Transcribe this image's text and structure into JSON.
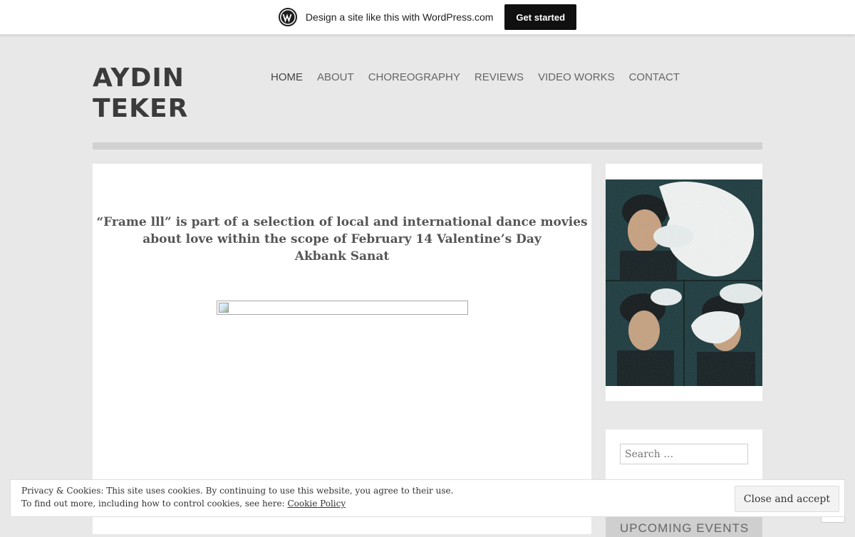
{
  "promo": {
    "text": "Design a site like this with WordPress.com",
    "button": "Get started",
    "logo_icon": "wordpress-logo-icon"
  },
  "site": {
    "title_line1": "AYDIN",
    "title_line2": "TEKER"
  },
  "nav": {
    "items": [
      {
        "label": "HOME",
        "current": true
      },
      {
        "label": "ABOUT"
      },
      {
        "label": "CHOREOGRAPHY"
      },
      {
        "label": "REVIEWS"
      },
      {
        "label": "VIDEO WORKS"
      },
      {
        "label": "CONTACT"
      }
    ]
  },
  "post": {
    "line1": "“Frame lll” is part of a selection of local and international dance movies",
    "line2": "about love within the scope of February 14 Valentine’s Day",
    "line3": "Akbank Sanat"
  },
  "sidebar": {
    "search_placeholder": "Search …",
    "events_title": "UPCOMING EVENTS"
  },
  "cookie": {
    "line1": "Privacy & Cookies: This site uses cookies. By continuing to use this website, you agree to their use.",
    "line2_prefix": "To find out more, including how to control cookies, see here: ",
    "policy_link": "Cookie Policy",
    "button": "Close and accept"
  },
  "colors": {
    "background": "#e8e8e8",
    "title": "#3b3b3b",
    "nav": "#666666",
    "promo_button": "#101010"
  }
}
